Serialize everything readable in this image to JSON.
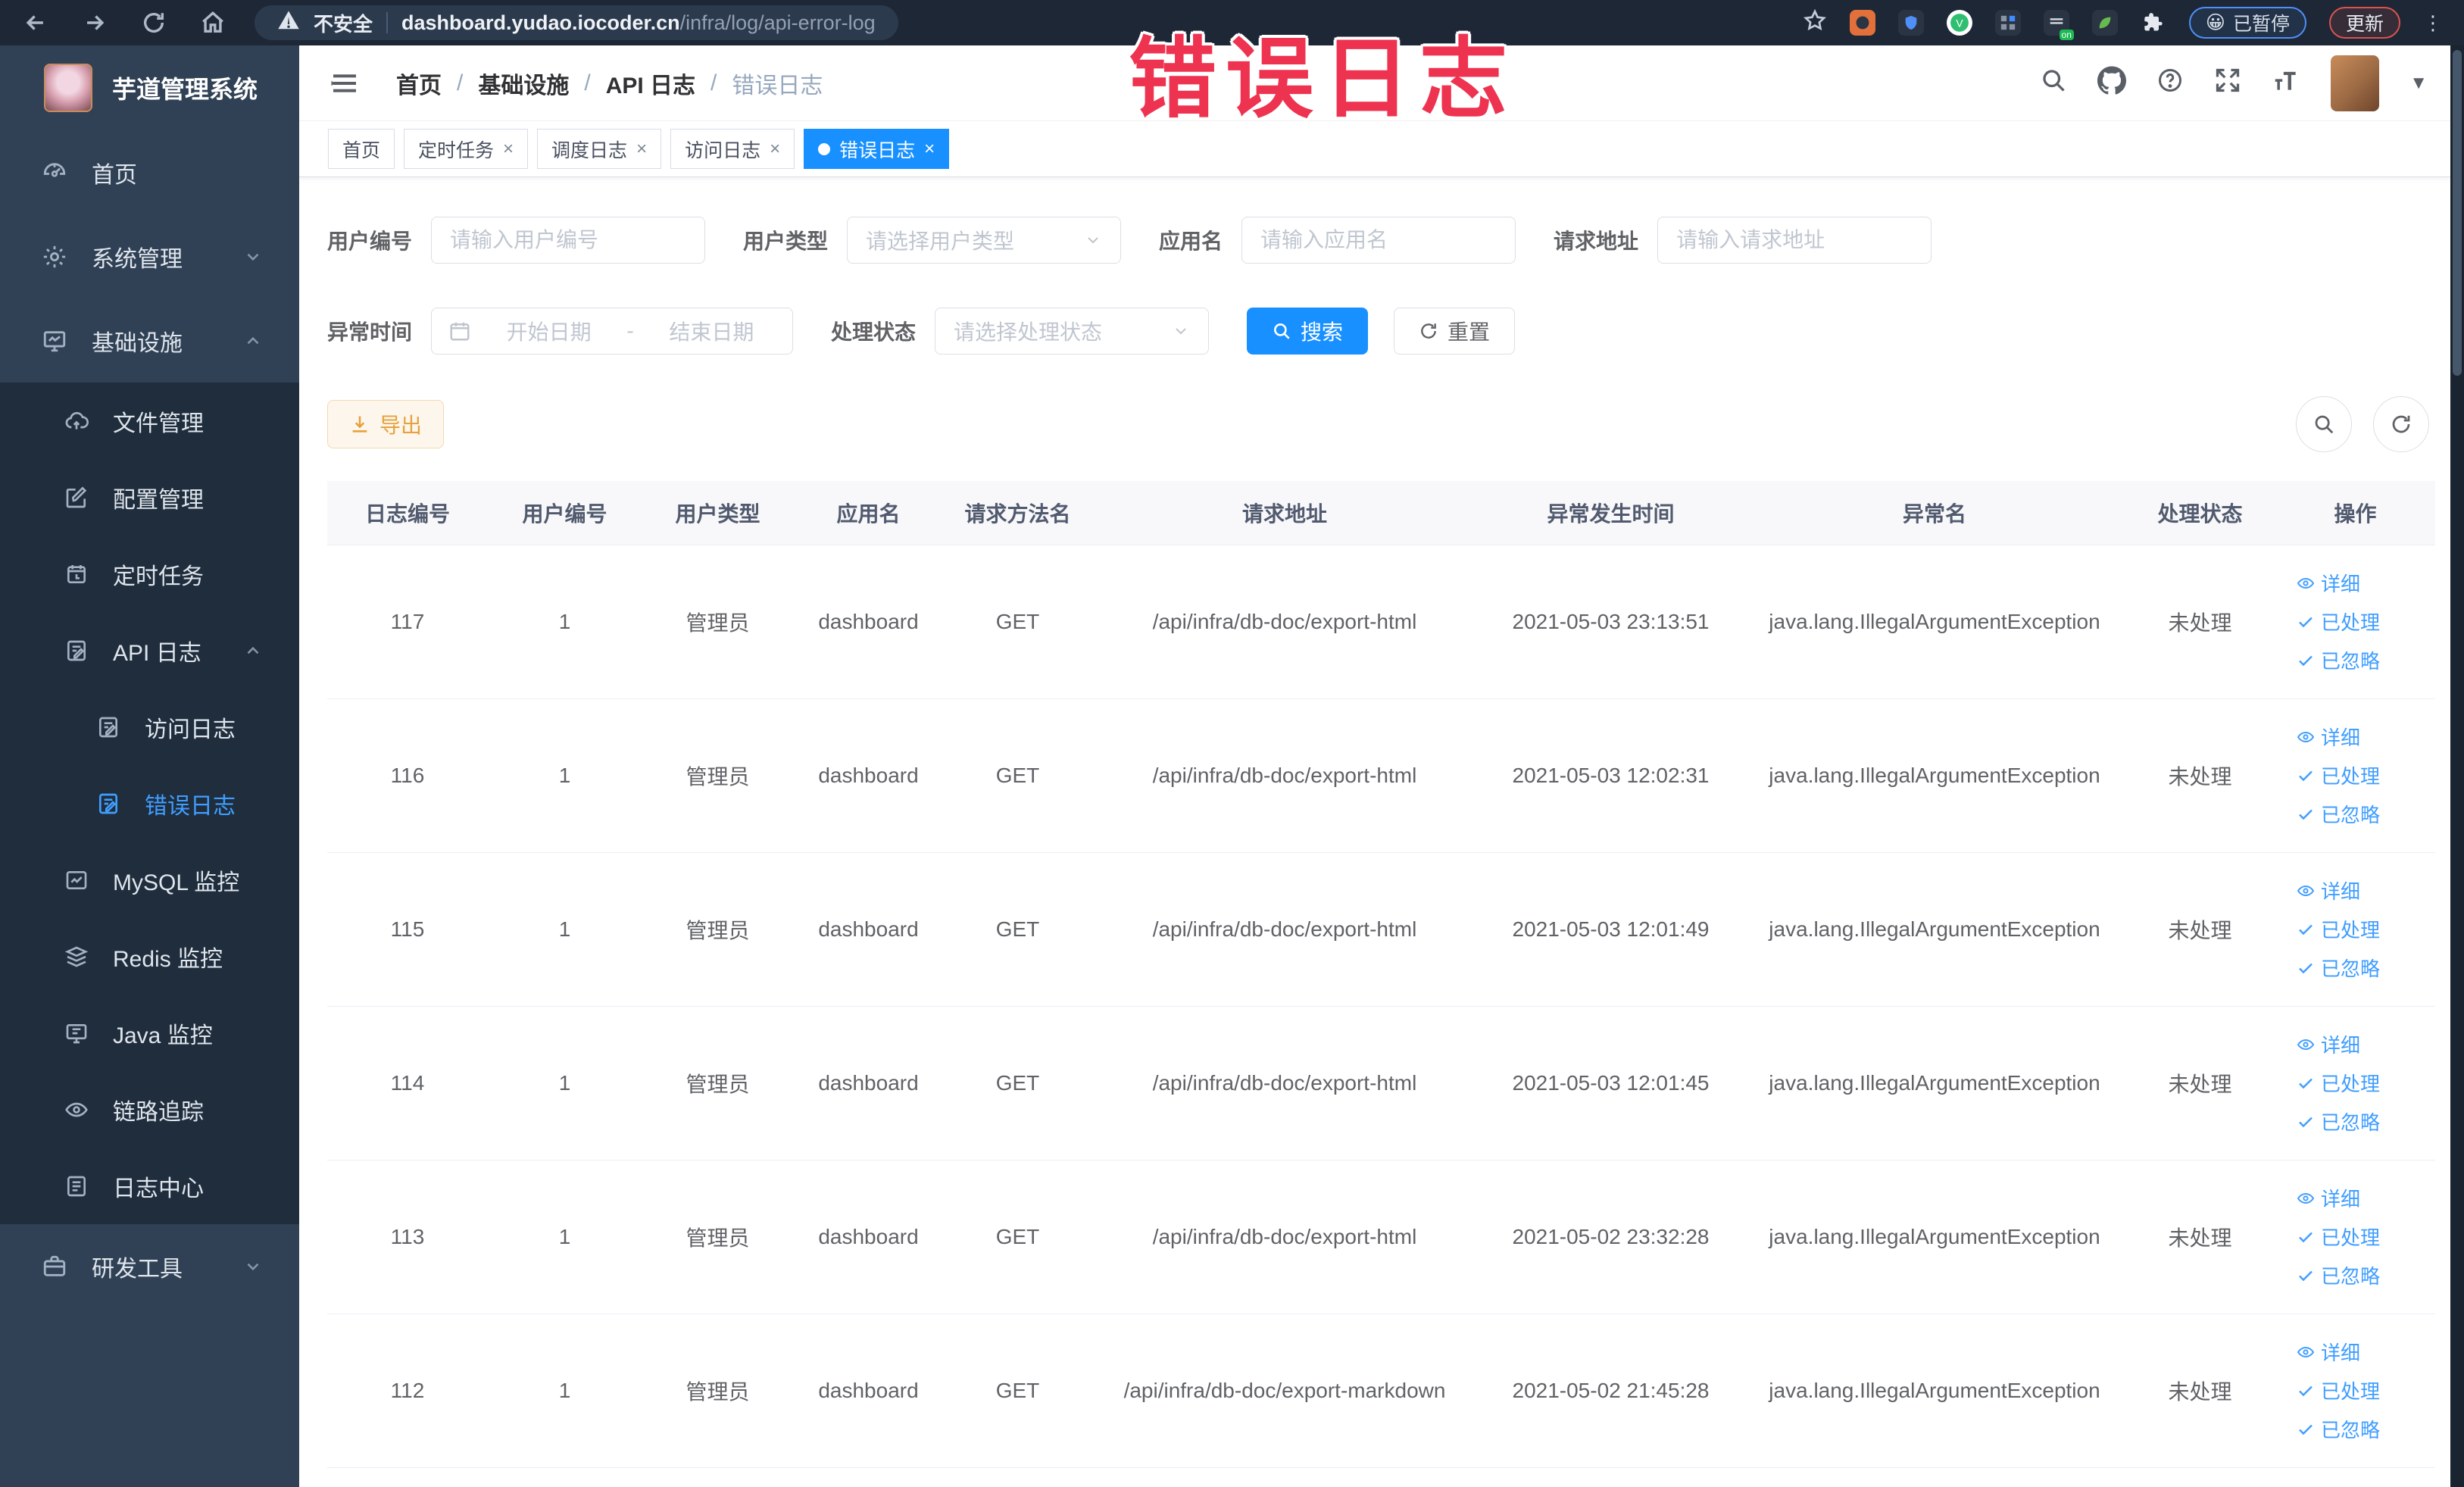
{
  "browser": {
    "security_label": "不安全",
    "url_domain": "dashboard.yudao.iocoder.cn",
    "url_path": "/infra/log/api-error-log",
    "paused_label": "已暂停",
    "update_label": "更新",
    "menu_glyph": "⋮"
  },
  "overlay": {
    "title": "错误日志",
    "color": "#ee3350"
  },
  "sidebar": {
    "app_title": "芋道管理系统",
    "items": [
      {
        "label": "首页"
      },
      {
        "label": "系统管理"
      },
      {
        "label": "基础设施"
      },
      {
        "label": "文件管理"
      },
      {
        "label": "配置管理"
      },
      {
        "label": "定时任务"
      },
      {
        "label": "API 日志"
      },
      {
        "label": "访问日志"
      },
      {
        "label": "错误日志"
      },
      {
        "label": "MySQL 监控"
      },
      {
        "label": "Redis 监控"
      },
      {
        "label": "Java 监控"
      },
      {
        "label": "链路追踪"
      },
      {
        "label": "日志中心"
      },
      {
        "label": "研发工具"
      }
    ]
  },
  "breadcrumb": {
    "separator": "/",
    "items": [
      "首页",
      "基础设施",
      "API 日志",
      "错误日志"
    ]
  },
  "tags": {
    "close_glyph": "×",
    "items": [
      {
        "label": "首页"
      },
      {
        "label": "定时任务"
      },
      {
        "label": "调度日志"
      },
      {
        "label": "访问日志"
      },
      {
        "label": "错误日志"
      }
    ]
  },
  "filters": {
    "user_id_label": "用户编号",
    "user_id_placeholder": "请输入用户编号",
    "user_type_label": "用户类型",
    "user_type_placeholder": "请选择用户类型",
    "app_name_label": "应用名",
    "app_name_placeholder": "请输入应用名",
    "request_url_label": "请求地址",
    "request_url_placeholder": "请输入请求地址",
    "exception_time_label": "异常时间",
    "date_start_placeholder": "开始日期",
    "date_separator": "-",
    "date_end_placeholder": "结束日期",
    "process_status_label": "处理状态",
    "process_status_placeholder": "请选择处理状态",
    "search_label": "搜索",
    "reset_label": "重置"
  },
  "toolbar": {
    "export_label": "导出"
  },
  "table": {
    "columns": [
      "日志编号",
      "用户编号",
      "用户类型",
      "应用名",
      "请求方法名",
      "请求地址",
      "异常发生时间",
      "异常名",
      "处理状态",
      "操作"
    ],
    "actions": {
      "detail": "详细",
      "processed": "已处理",
      "ignored": "已忽略"
    },
    "rows": [
      {
        "id": "117",
        "user_id": "1",
        "user_type": "管理员",
        "app_name": "dashboard",
        "method": "GET",
        "url": "/api/infra/db-doc/export-html",
        "time": "2021-05-03 23:13:51",
        "exception": "java.lang.IllegalArgumentException",
        "status": "未处理"
      },
      {
        "id": "116",
        "user_id": "1",
        "user_type": "管理员",
        "app_name": "dashboard",
        "method": "GET",
        "url": "/api/infra/db-doc/export-html",
        "time": "2021-05-03 12:02:31",
        "exception": "java.lang.IllegalArgumentException",
        "status": "未处理"
      },
      {
        "id": "115",
        "user_id": "1",
        "user_type": "管理员",
        "app_name": "dashboard",
        "method": "GET",
        "url": "/api/infra/db-doc/export-html",
        "time": "2021-05-03 12:01:49",
        "exception": "java.lang.IllegalArgumentException",
        "status": "未处理"
      },
      {
        "id": "114",
        "user_id": "1",
        "user_type": "管理员",
        "app_name": "dashboard",
        "method": "GET",
        "url": "/api/infra/db-doc/export-html",
        "time": "2021-05-03 12:01:45",
        "exception": "java.lang.IllegalArgumentException",
        "status": "未处理"
      },
      {
        "id": "113",
        "user_id": "1",
        "user_type": "管理员",
        "app_name": "dashboard",
        "method": "GET",
        "url": "/api/infra/db-doc/export-html",
        "time": "2021-05-02 23:32:28",
        "exception": "java.lang.IllegalArgumentException",
        "status": "未处理"
      },
      {
        "id": "112",
        "user_id": "1",
        "user_type": "管理员",
        "app_name": "dashboard",
        "method": "GET",
        "url": "/api/infra/db-doc/export-markdown",
        "time": "2021-05-02 21:45:28",
        "exception": "java.lang.IllegalArgumentException",
        "status": "未处理"
      }
    ]
  },
  "colors": {
    "accent": "#1890ff",
    "link": "#409eff",
    "warning": "#e6a23c",
    "sidebar_bg": "#304156",
    "submenu_bg": "#1f2d3d"
  }
}
